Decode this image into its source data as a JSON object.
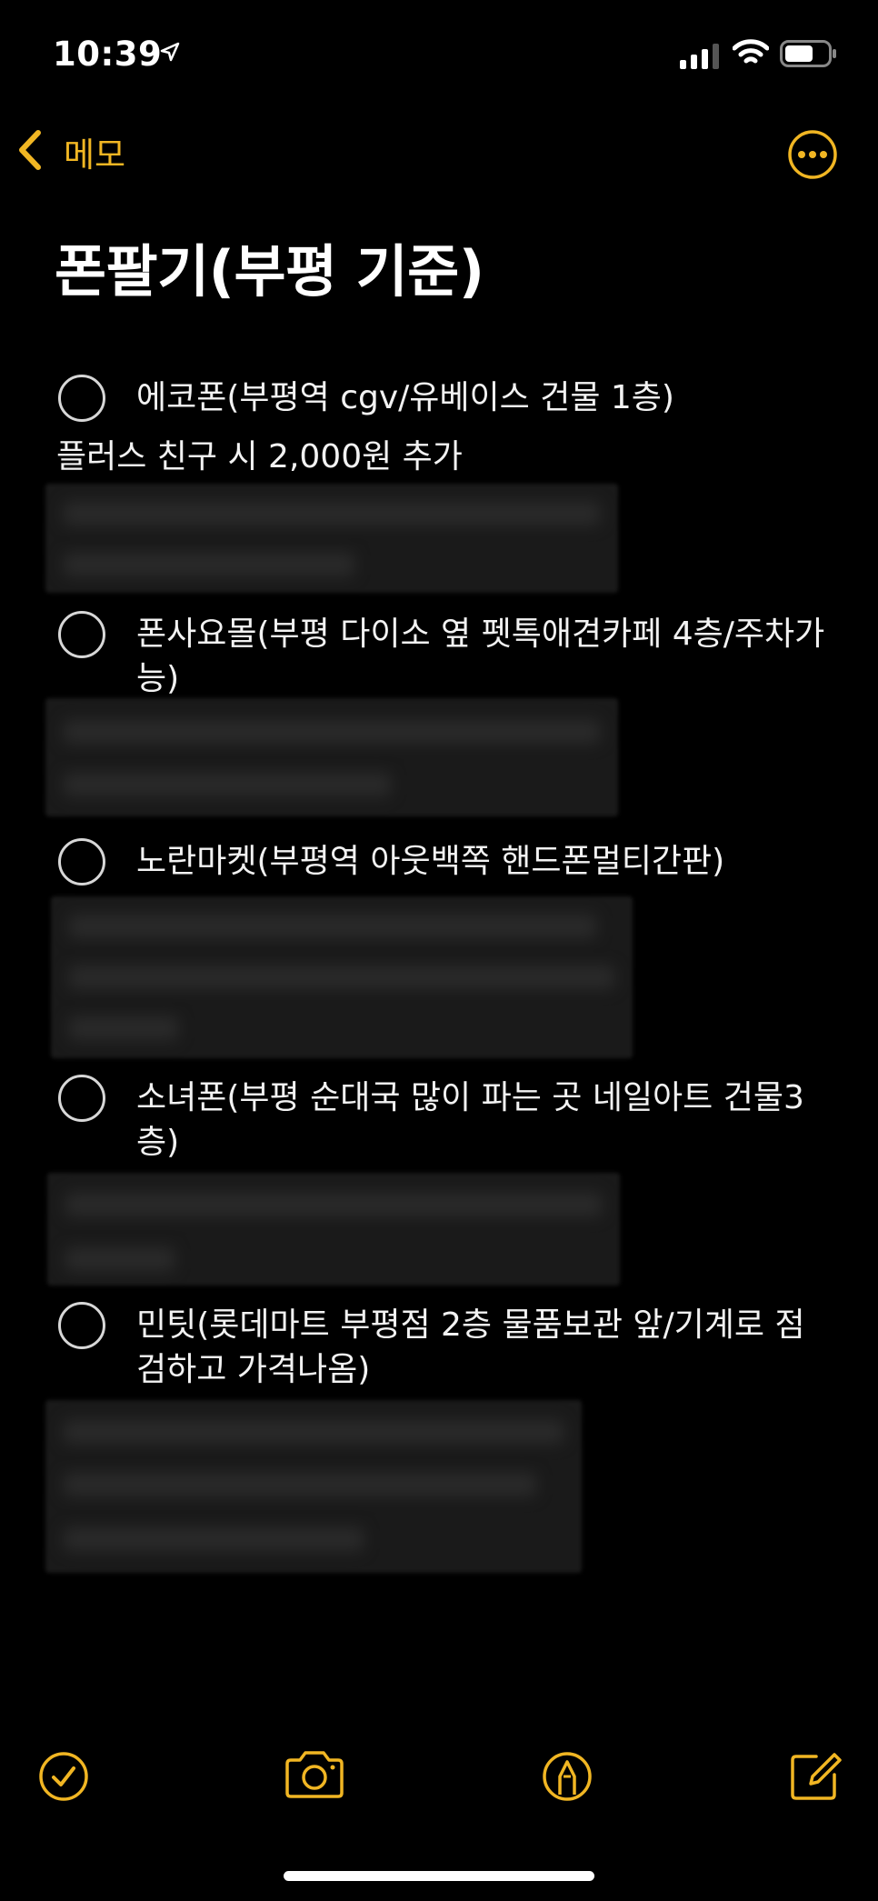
{
  "status_bar": {
    "time": "10:39"
  },
  "nav": {
    "back_label": "메모"
  },
  "note": {
    "title": "폰팔기(부평 기준)",
    "items": [
      {
        "label": "에코폰(부평역 cgv/유베이스 건물 1층)"
      },
      {
        "label": "폰사요몰(부평 다이소 옆 펫톡애견카페 4층/주차가능)"
      },
      {
        "label": "노란마켓(부평역 아웃백쪽 핸드폰멀티간판)"
      },
      {
        "label": "소녀폰(부평 순대국 많이 파는 곳 네일아트 건물3층)"
      },
      {
        "label": "민팃(롯데마트 부평점 2층 물품보관 앞/기계로 점검하고 가격나옴)"
      }
    ],
    "extra_line": "플러스 친구 시 2,000원 추가"
  },
  "toolbar": {
    "checklist_icon": "checklist-icon",
    "camera_icon": "camera-icon",
    "markup_icon": "markup-pen-icon",
    "compose_icon": "compose-icon"
  },
  "colors": {
    "accent": "#f1b623",
    "background": "#000000"
  }
}
